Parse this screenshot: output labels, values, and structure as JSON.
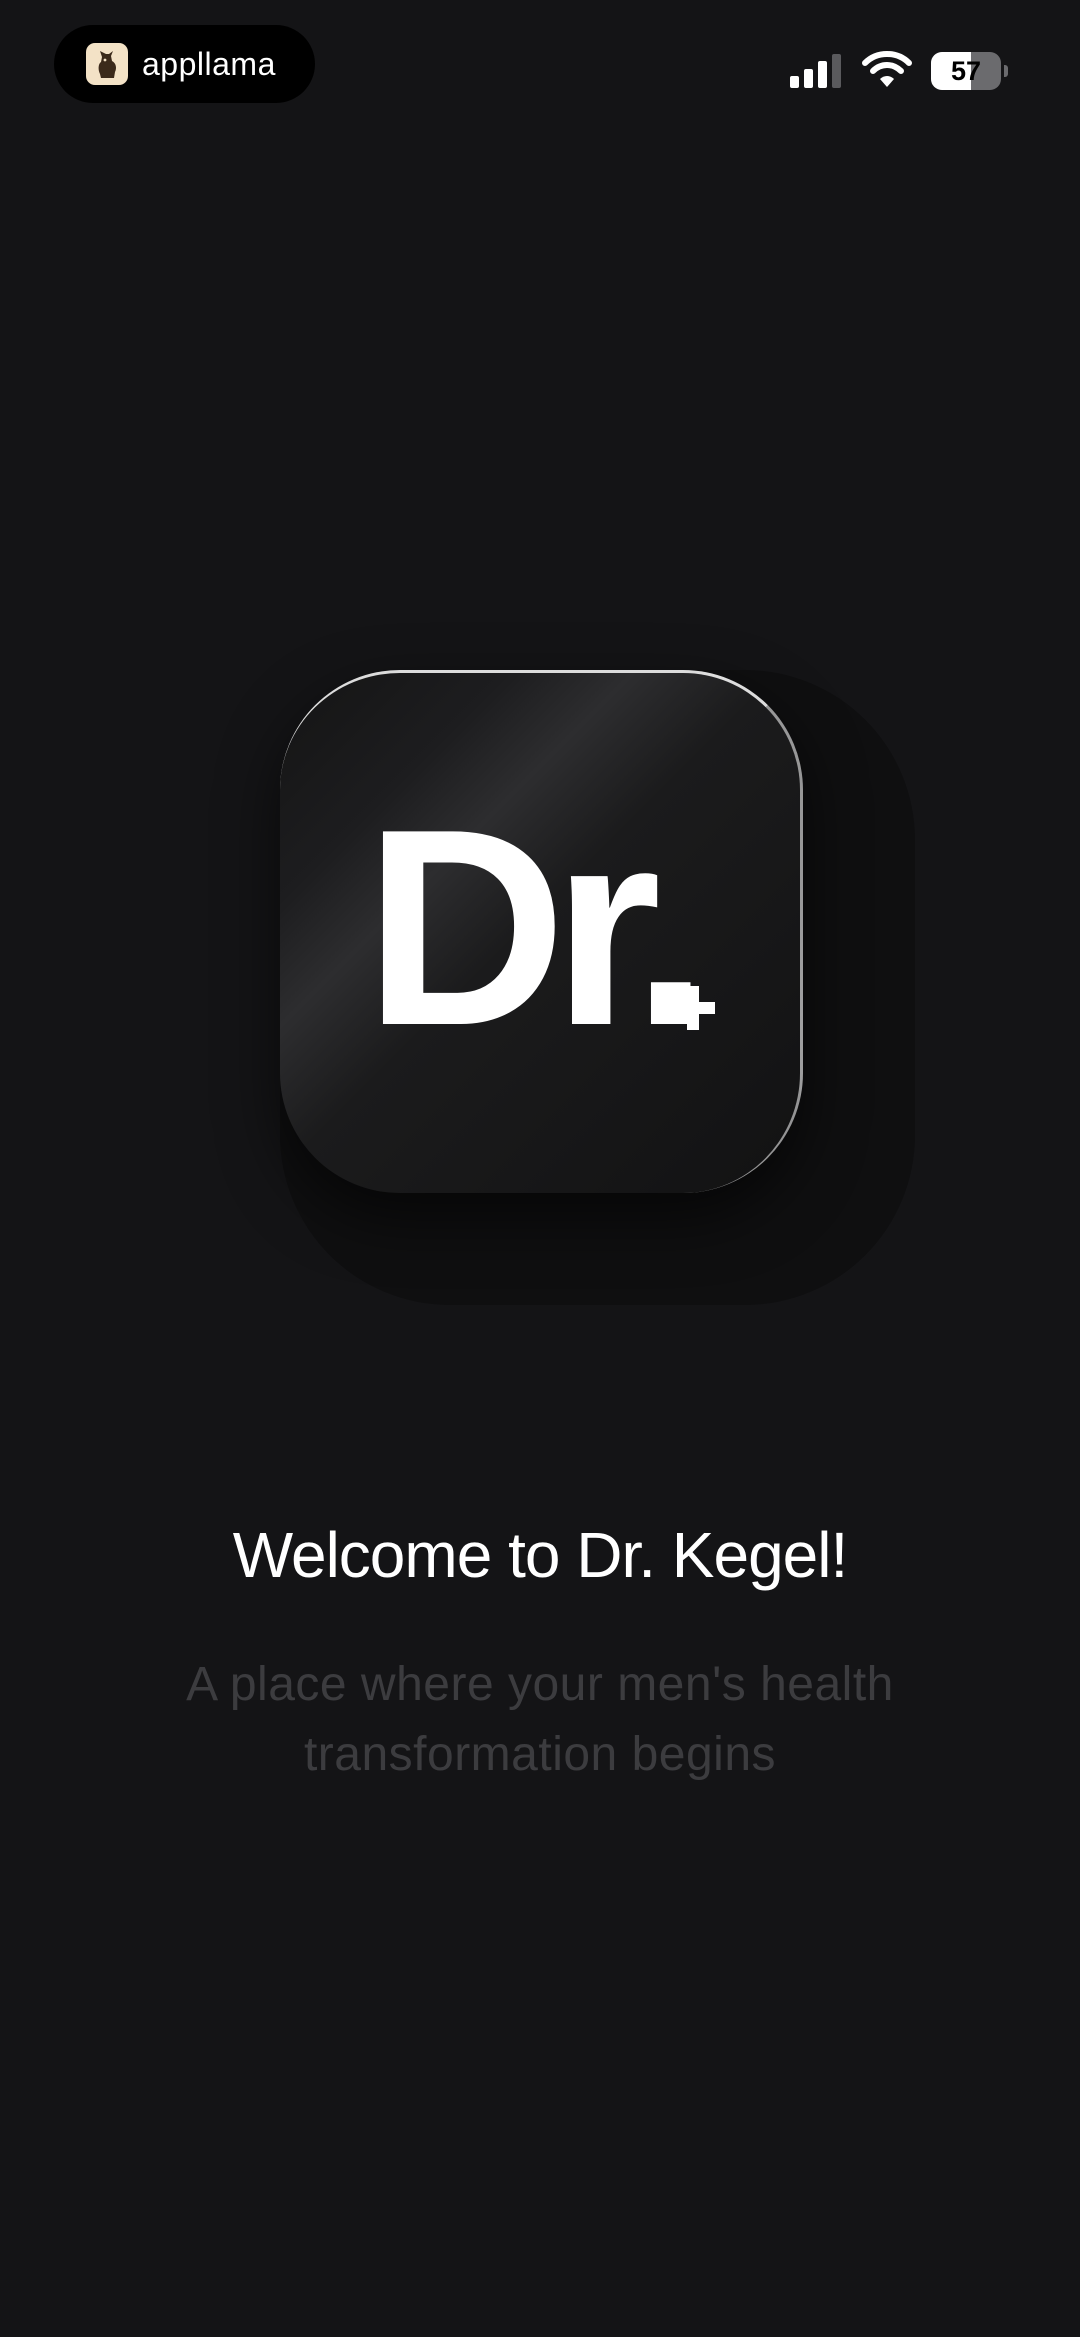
{
  "status_bar": {
    "recorder_brand": "appllama",
    "battery_percent": "57",
    "battery_level": 0.57,
    "signal_bars": 3,
    "signal_bars_max": 4
  },
  "app_icon": {
    "mark_text": "Dr.",
    "plus_glyph": "+"
  },
  "welcome": {
    "title": "Welcome to Dr. Kegel!",
    "subtitle": "A place where your men's health transformation begins"
  },
  "colors": {
    "background": "#141416",
    "title": "#ffffff",
    "subtitle": "#3c3c3f"
  }
}
